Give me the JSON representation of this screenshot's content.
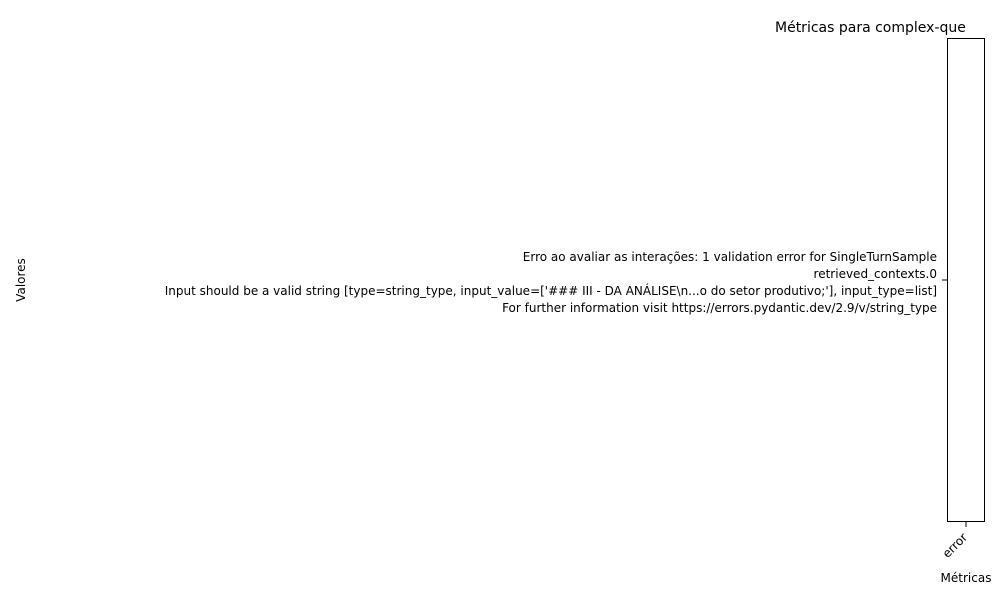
{
  "chart_data": {
    "type": "bar",
    "title": "Métricas para complex-que",
    "xlabel": "Métricas",
    "ylabel": "Valores",
    "categories": [
      "error"
    ],
    "y_tick_labels": [
      "Erro ao avaliar as interações: 1 validation error for SingleTurnSample",
      "retrieved_contexts.0",
      "  Input should be a valid string [type=string_type, input_value=['### III - DA ANÁLISE\\n...o do setor produtivo;'], input_type=list]",
      "    For further information visit https://errors.pydantic.dev/2.9/v/string_type"
    ],
    "x_tick_rotation_deg": 45,
    "grid": false,
    "colors": {
      "axes": "#000000",
      "background": "#ffffff"
    }
  }
}
